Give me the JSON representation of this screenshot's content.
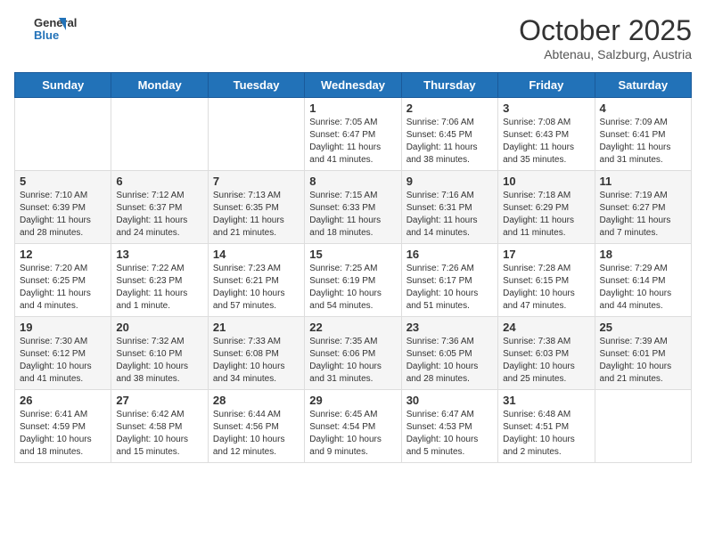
{
  "header": {
    "logo_general": "General",
    "logo_blue": "Blue",
    "month": "October 2025",
    "location": "Abtenau, Salzburg, Austria"
  },
  "weekdays": [
    "Sunday",
    "Monday",
    "Tuesday",
    "Wednesday",
    "Thursday",
    "Friday",
    "Saturday"
  ],
  "weeks": [
    [
      {
        "day": "",
        "sunrise": "",
        "sunset": "",
        "daylight": ""
      },
      {
        "day": "",
        "sunrise": "",
        "sunset": "",
        "daylight": ""
      },
      {
        "day": "",
        "sunrise": "",
        "sunset": "",
        "daylight": ""
      },
      {
        "day": "1",
        "sunrise": "Sunrise: 7:05 AM",
        "sunset": "Sunset: 6:47 PM",
        "daylight": "Daylight: 11 hours and 41 minutes."
      },
      {
        "day": "2",
        "sunrise": "Sunrise: 7:06 AM",
        "sunset": "Sunset: 6:45 PM",
        "daylight": "Daylight: 11 hours and 38 minutes."
      },
      {
        "day": "3",
        "sunrise": "Sunrise: 7:08 AM",
        "sunset": "Sunset: 6:43 PM",
        "daylight": "Daylight: 11 hours and 35 minutes."
      },
      {
        "day": "4",
        "sunrise": "Sunrise: 7:09 AM",
        "sunset": "Sunset: 6:41 PM",
        "daylight": "Daylight: 11 hours and 31 minutes."
      }
    ],
    [
      {
        "day": "5",
        "sunrise": "Sunrise: 7:10 AM",
        "sunset": "Sunset: 6:39 PM",
        "daylight": "Daylight: 11 hours and 28 minutes."
      },
      {
        "day": "6",
        "sunrise": "Sunrise: 7:12 AM",
        "sunset": "Sunset: 6:37 PM",
        "daylight": "Daylight: 11 hours and 24 minutes."
      },
      {
        "day": "7",
        "sunrise": "Sunrise: 7:13 AM",
        "sunset": "Sunset: 6:35 PM",
        "daylight": "Daylight: 11 hours and 21 minutes."
      },
      {
        "day": "8",
        "sunrise": "Sunrise: 7:15 AM",
        "sunset": "Sunset: 6:33 PM",
        "daylight": "Daylight: 11 hours and 18 minutes."
      },
      {
        "day": "9",
        "sunrise": "Sunrise: 7:16 AM",
        "sunset": "Sunset: 6:31 PM",
        "daylight": "Daylight: 11 hours and 14 minutes."
      },
      {
        "day": "10",
        "sunrise": "Sunrise: 7:18 AM",
        "sunset": "Sunset: 6:29 PM",
        "daylight": "Daylight: 11 hours and 11 minutes."
      },
      {
        "day": "11",
        "sunrise": "Sunrise: 7:19 AM",
        "sunset": "Sunset: 6:27 PM",
        "daylight": "Daylight: 11 hours and 7 minutes."
      }
    ],
    [
      {
        "day": "12",
        "sunrise": "Sunrise: 7:20 AM",
        "sunset": "Sunset: 6:25 PM",
        "daylight": "Daylight: 11 hours and 4 minutes."
      },
      {
        "day": "13",
        "sunrise": "Sunrise: 7:22 AM",
        "sunset": "Sunset: 6:23 PM",
        "daylight": "Daylight: 11 hours and 1 minute."
      },
      {
        "day": "14",
        "sunrise": "Sunrise: 7:23 AM",
        "sunset": "Sunset: 6:21 PM",
        "daylight": "Daylight: 10 hours and 57 minutes."
      },
      {
        "day": "15",
        "sunrise": "Sunrise: 7:25 AM",
        "sunset": "Sunset: 6:19 PM",
        "daylight": "Daylight: 10 hours and 54 minutes."
      },
      {
        "day": "16",
        "sunrise": "Sunrise: 7:26 AM",
        "sunset": "Sunset: 6:17 PM",
        "daylight": "Daylight: 10 hours and 51 minutes."
      },
      {
        "day": "17",
        "sunrise": "Sunrise: 7:28 AM",
        "sunset": "Sunset: 6:15 PM",
        "daylight": "Daylight: 10 hours and 47 minutes."
      },
      {
        "day": "18",
        "sunrise": "Sunrise: 7:29 AM",
        "sunset": "Sunset: 6:14 PM",
        "daylight": "Daylight: 10 hours and 44 minutes."
      }
    ],
    [
      {
        "day": "19",
        "sunrise": "Sunrise: 7:30 AM",
        "sunset": "Sunset: 6:12 PM",
        "daylight": "Daylight: 10 hours and 41 minutes."
      },
      {
        "day": "20",
        "sunrise": "Sunrise: 7:32 AM",
        "sunset": "Sunset: 6:10 PM",
        "daylight": "Daylight: 10 hours and 38 minutes."
      },
      {
        "day": "21",
        "sunrise": "Sunrise: 7:33 AM",
        "sunset": "Sunset: 6:08 PM",
        "daylight": "Daylight: 10 hours and 34 minutes."
      },
      {
        "day": "22",
        "sunrise": "Sunrise: 7:35 AM",
        "sunset": "Sunset: 6:06 PM",
        "daylight": "Daylight: 10 hours and 31 minutes."
      },
      {
        "day": "23",
        "sunrise": "Sunrise: 7:36 AM",
        "sunset": "Sunset: 6:05 PM",
        "daylight": "Daylight: 10 hours and 28 minutes."
      },
      {
        "day": "24",
        "sunrise": "Sunrise: 7:38 AM",
        "sunset": "Sunset: 6:03 PM",
        "daylight": "Daylight: 10 hours and 25 minutes."
      },
      {
        "day": "25",
        "sunrise": "Sunrise: 7:39 AM",
        "sunset": "Sunset: 6:01 PM",
        "daylight": "Daylight: 10 hours and 21 minutes."
      }
    ],
    [
      {
        "day": "26",
        "sunrise": "Sunrise: 6:41 AM",
        "sunset": "Sunset: 4:59 PM",
        "daylight": "Daylight: 10 hours and 18 minutes."
      },
      {
        "day": "27",
        "sunrise": "Sunrise: 6:42 AM",
        "sunset": "Sunset: 4:58 PM",
        "daylight": "Daylight: 10 hours and 15 minutes."
      },
      {
        "day": "28",
        "sunrise": "Sunrise: 6:44 AM",
        "sunset": "Sunset: 4:56 PM",
        "daylight": "Daylight: 10 hours and 12 minutes."
      },
      {
        "day": "29",
        "sunrise": "Sunrise: 6:45 AM",
        "sunset": "Sunset: 4:54 PM",
        "daylight": "Daylight: 10 hours and 9 minutes."
      },
      {
        "day": "30",
        "sunrise": "Sunrise: 6:47 AM",
        "sunset": "Sunset: 4:53 PM",
        "daylight": "Daylight: 10 hours and 5 minutes."
      },
      {
        "day": "31",
        "sunrise": "Sunrise: 6:48 AM",
        "sunset": "Sunset: 4:51 PM",
        "daylight": "Daylight: 10 hours and 2 minutes."
      },
      {
        "day": "",
        "sunrise": "",
        "sunset": "",
        "daylight": ""
      }
    ]
  ]
}
